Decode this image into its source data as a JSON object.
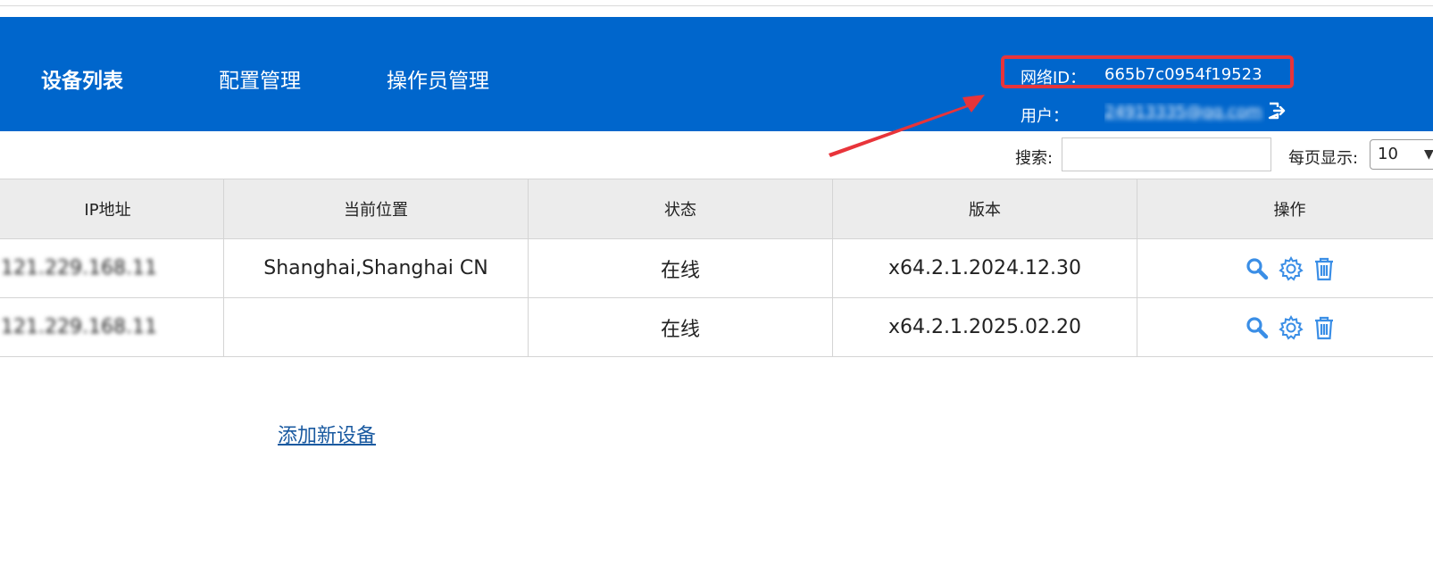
{
  "nav": {
    "items": [
      {
        "label": "设备列表",
        "active": true
      },
      {
        "label": "配置管理",
        "active": false
      },
      {
        "label": "操作员管理",
        "active": false
      }
    ]
  },
  "account": {
    "network_id_label": "网络ID：",
    "network_id": "665b7c0954f19523",
    "user_label": "用户：",
    "user_value": "24913335@qq.com",
    "logout_icon": "logout-icon"
  },
  "toolbar": {
    "search_label": "搜索:",
    "search_value": "",
    "per_page_label": "每页显示:",
    "per_page_value": "10"
  },
  "table": {
    "columns": [
      "IP地址",
      "当前位置",
      "状态",
      "版本",
      "操作"
    ],
    "rows": [
      {
        "ip": "121.229.168.11",
        "location": "Shanghai,Shanghai CN",
        "status": "在线",
        "version": "x64.2.1.2024.12.30",
        "actions": [
          "search-icon",
          "gear-icon",
          "trash-icon"
        ]
      },
      {
        "ip": "121.229.168.11",
        "location": "",
        "status": "在线",
        "version": "x64.2.1.2025.02.20",
        "actions": [
          "search-icon",
          "gear-icon",
          "trash-icon"
        ]
      }
    ]
  },
  "add_device_label": "添加新设备",
  "colors": {
    "header_bg": "#0066cc",
    "highlight_border": "#e8343a",
    "status_online": "#1d8a1d",
    "icon_blue": "#3a8ee6"
  }
}
